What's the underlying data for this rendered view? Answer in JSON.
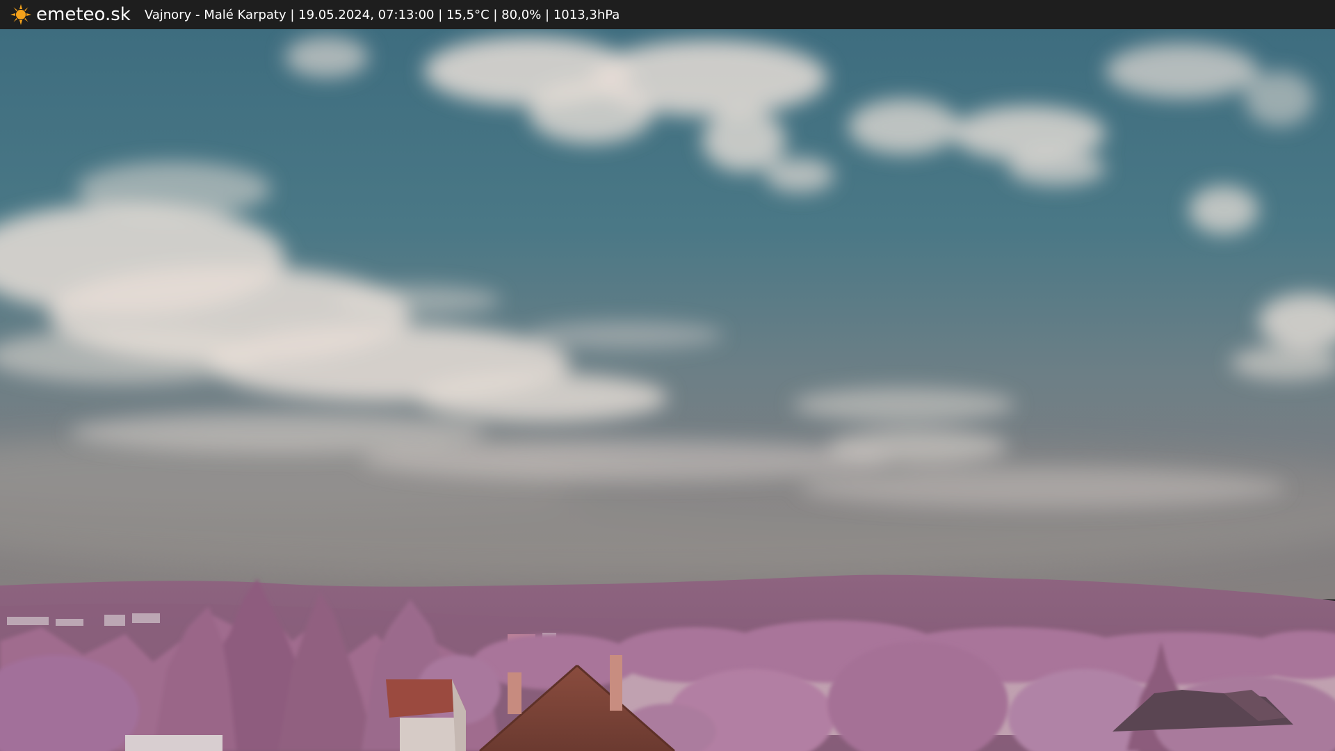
{
  "header": {
    "brand": "emeteo.sk",
    "brand_icon": "sun-icon",
    "caption": "Vajnory - Malé Karpaty | 19.05.2024, 07:13:00 | 15,5°C | 80,0% | 1013,3hPa"
  },
  "colors": {
    "header_bg": "#1e1e1e",
    "sun": "#f5a21b",
    "sky_top": "#3f6e80",
    "sky_horizon": "#7a7f84",
    "foliage": "#b27a9c",
    "roof": "#9a4a3a"
  }
}
